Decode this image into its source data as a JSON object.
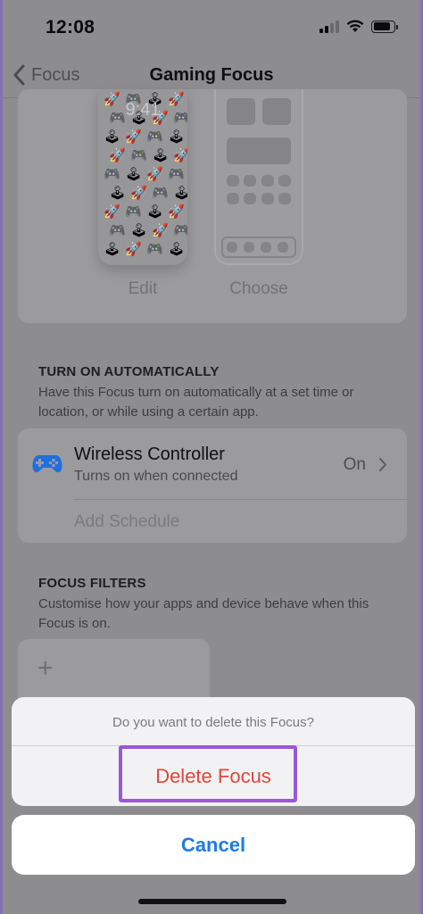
{
  "status_bar": {
    "time": "12:08"
  },
  "nav": {
    "back_label": "Focus",
    "title": "Gaming Focus"
  },
  "customize": {
    "lock_preview_time": "9:41",
    "edit_label": "Edit",
    "choose_label": "Choose"
  },
  "turn_on": {
    "header": "TURN ON AUTOMATICALLY",
    "description": "Have this Focus turn on automatically at a set time or location, or while using a certain app.",
    "item": {
      "title": "Wireless Controller",
      "subtitle": "Turns on when connected",
      "value": "On"
    },
    "add_schedule": "Add Schedule"
  },
  "filters": {
    "header": "FOCUS FILTERS",
    "description": "Customise how your apps and device behave when this Focus is on.",
    "add_symbol": "+"
  },
  "action_sheet": {
    "message": "Do you want to delete this Focus?",
    "delete_label": "Delete Focus",
    "cancel_label": "Cancel"
  },
  "colors": {
    "delete": "#e0463b",
    "cancel": "#1f7ae6",
    "highlight": "#9a57d6",
    "controller": "#1f6fe0"
  }
}
